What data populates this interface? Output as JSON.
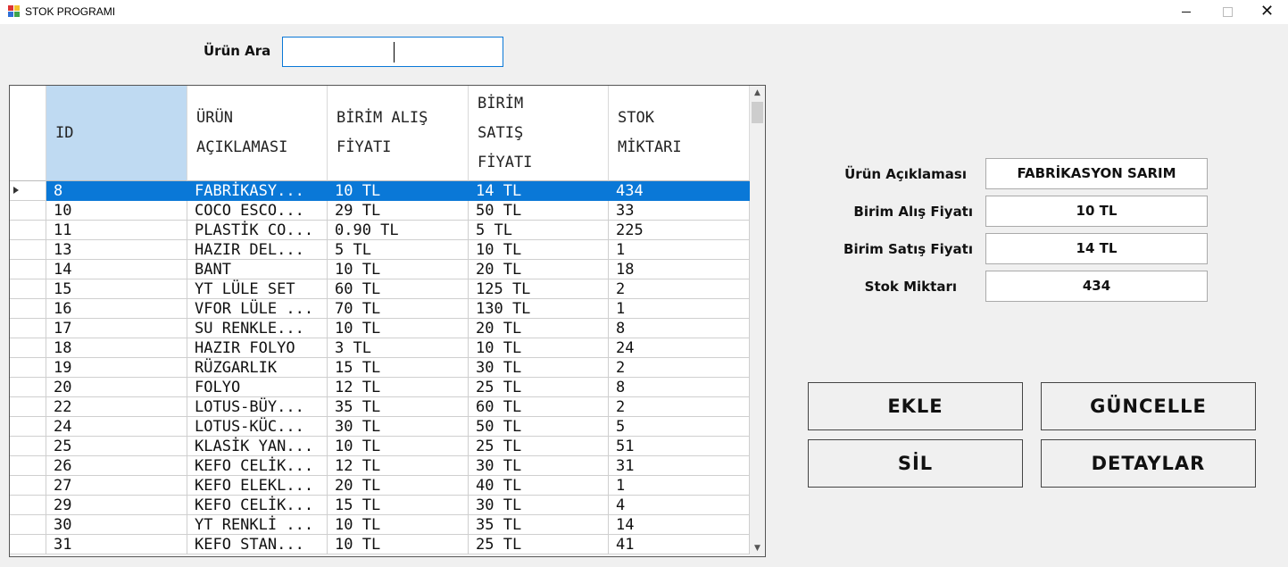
{
  "window": {
    "title": "STOK PROGRAMI",
    "minimize_glyph": "",
    "close_glyph": "✕"
  },
  "search": {
    "label": "Ürün Ara",
    "value": ""
  },
  "grid": {
    "columns": [
      "ID",
      "ÜRÜN AÇIKLAMASI",
      "BİRİM ALIŞ FİYATI",
      "BİRİM SATIŞ FİYATI",
      "STOK MİKTARI"
    ],
    "selected_row": 0,
    "rows": [
      [
        "8",
        "FABRİKASY...",
        "10 TL",
        "14 TL",
        "434"
      ],
      [
        "10",
        "COCO ESCO...",
        "29 TL",
        "50 TL",
        "33"
      ],
      [
        "11",
        "PLASTİK CO...",
        "0.90 TL",
        "5 TL",
        "225"
      ],
      [
        "13",
        "HAZIR DEL...",
        "5 TL",
        "10 TL",
        "1"
      ],
      [
        "14",
        "BANT",
        "10 TL",
        "20 TL",
        "18"
      ],
      [
        "15",
        "YT LÜLE SET",
        "60 TL",
        "125 TL",
        "2"
      ],
      [
        "16",
        "VFOR LÜLE ...",
        "70 TL",
        "130 TL",
        "1"
      ],
      [
        "17",
        "SU RENKLE...",
        "10 TL",
        "20 TL",
        "8"
      ],
      [
        "18",
        "HAZIR FOLYO",
        "3 TL",
        "10 TL",
        "24"
      ],
      [
        "19",
        "RÜZGARLIK",
        "15 TL",
        "30 TL",
        "2"
      ],
      [
        "20",
        "FOLYO",
        "12 TL",
        "25 TL",
        "8"
      ],
      [
        "22",
        "LOTUS-BÜY...",
        "35 TL",
        "60 TL",
        "2"
      ],
      [
        "24",
        "LOTUS-KÜC...",
        "30 TL",
        "50 TL",
        "5"
      ],
      [
        "25",
        "KLASİK YAN...",
        "10 TL",
        "25 TL",
        "51"
      ],
      [
        "26",
        "KEFO CELİK...",
        "12 TL",
        "30 TL",
        "31"
      ],
      [
        "27",
        "KEFO ELEKL...",
        "20 TL",
        "40 TL",
        "1"
      ],
      [
        "29",
        "KEFO CELİK...",
        "15 TL",
        "30 TL",
        "4"
      ],
      [
        "30",
        "YT RENKLİ ...",
        "10 TL",
        "35 TL",
        "14"
      ],
      [
        "31",
        "KEFO STAN...",
        "10 TL",
        "25 TL",
        "41"
      ]
    ]
  },
  "details": {
    "aciklama_label": "Ürün Açıklaması",
    "aciklama_value": "FABRİKASYON SARIM",
    "alis_label": "Birim Alış Fiyatı",
    "alis_value": "10 TL",
    "satis_label": "Birim Satış Fiyatı",
    "satis_value": "14 TL",
    "stok_label": "Stok Miktarı",
    "stok_value": "434"
  },
  "buttons": {
    "ekle": "EKLE",
    "guncelle": "GÜNCELLE",
    "sil": "SİL",
    "detaylar": "DETAYLAR"
  }
}
